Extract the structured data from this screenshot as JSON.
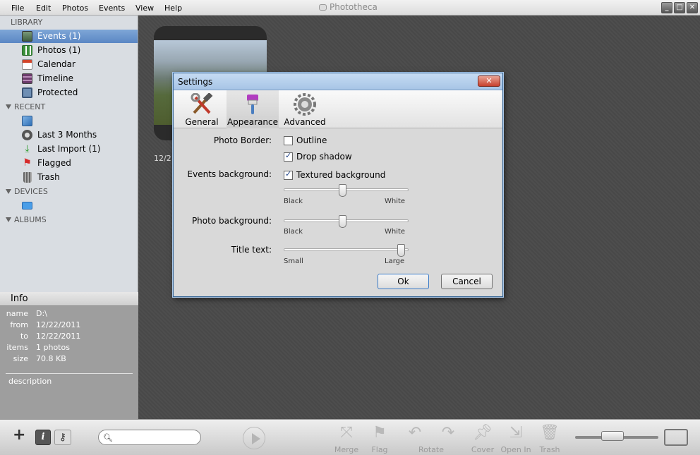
{
  "menubar": {
    "items": [
      "File",
      "Edit",
      "Photos",
      "Events",
      "View",
      "Help"
    ],
    "app_title": "Phototheca"
  },
  "sidebar": {
    "library_header": "LIBRARY",
    "library": [
      {
        "label": "Events (1)",
        "icon": "events-icon",
        "selected": true
      },
      {
        "label": "Photos (1)",
        "icon": "photos-icon"
      },
      {
        "label": "Calendar",
        "icon": "calendar-icon"
      },
      {
        "label": "Timeline",
        "icon": "timeline-icon"
      },
      {
        "label": "Protected",
        "icon": "protected-icon"
      }
    ],
    "recent_header": "RECENT",
    "recent": [
      {
        "label": "",
        "icon": "edit-icon"
      },
      {
        "label": "Last 3 Months",
        "icon": "clock-icon"
      },
      {
        "label": "Last Import (1)",
        "icon": "import-icon"
      },
      {
        "label": "Flagged",
        "icon": "flag-icon"
      },
      {
        "label": "Trash",
        "icon": "trash-icon"
      }
    ],
    "devices_header": "DEVICES",
    "devices": [
      {
        "label": "",
        "icon": "device-icon"
      }
    ],
    "albums_header": "ALBUMS"
  },
  "info": {
    "title": "Info",
    "rows": [
      {
        "key": "name",
        "value": "D:\\"
      },
      {
        "key": "from",
        "value": "12/22/2011"
      },
      {
        "key": "to",
        "value": "12/22/2011"
      },
      {
        "key": "items",
        "value": "1 photos"
      },
      {
        "key": "size",
        "value": "70.8 KB"
      }
    ],
    "description": "description"
  },
  "main": {
    "event_date": "12/2"
  },
  "dialog": {
    "title": "Settings",
    "close_label": "✕",
    "tabs": [
      {
        "label": "General",
        "icon": "general-tools-icon"
      },
      {
        "label": "Appearance",
        "icon": "appearance-brush-icon",
        "selected": true
      },
      {
        "label": "Advanced",
        "icon": "advanced-gear-icon"
      }
    ],
    "photo_border_label": "Photo Border:",
    "outline_label": "Outline",
    "outline_checked": false,
    "drop_shadow_label": "Drop shadow",
    "drop_shadow_checked": true,
    "events_bg_label": "Events background:",
    "textured_bg_label": "Textured background",
    "textured_bg_checked": true,
    "events_bg_slider": {
      "min_label": "Black",
      "max_label": "White",
      "value": 0.47
    },
    "photo_bg_label": "Photo background:",
    "photo_bg_slider": {
      "min_label": "Black",
      "max_label": "White",
      "value": 0.47
    },
    "title_text_label": "Title text:",
    "title_text_slider": {
      "min_label": "Small",
      "max_label": "Large",
      "value": 0.97
    },
    "ok_label": "Ok",
    "cancel_label": "Cancel"
  },
  "toolbar": {
    "search_placeholder": "",
    "tools": [
      {
        "label": "Merge",
        "icon": "merge-icon"
      },
      {
        "label": "Flag",
        "icon": "flag-icon"
      },
      {
        "label": "Rotate",
        "icon": "rotate-left-icon"
      },
      {
        "label": "",
        "icon": "rotate-right-icon"
      },
      {
        "label": "Cover",
        "icon": "cover-pin-icon"
      },
      {
        "label": "Open In",
        "icon": "open-in-icon"
      },
      {
        "label": "Trash",
        "icon": "trash-icon"
      }
    ]
  }
}
